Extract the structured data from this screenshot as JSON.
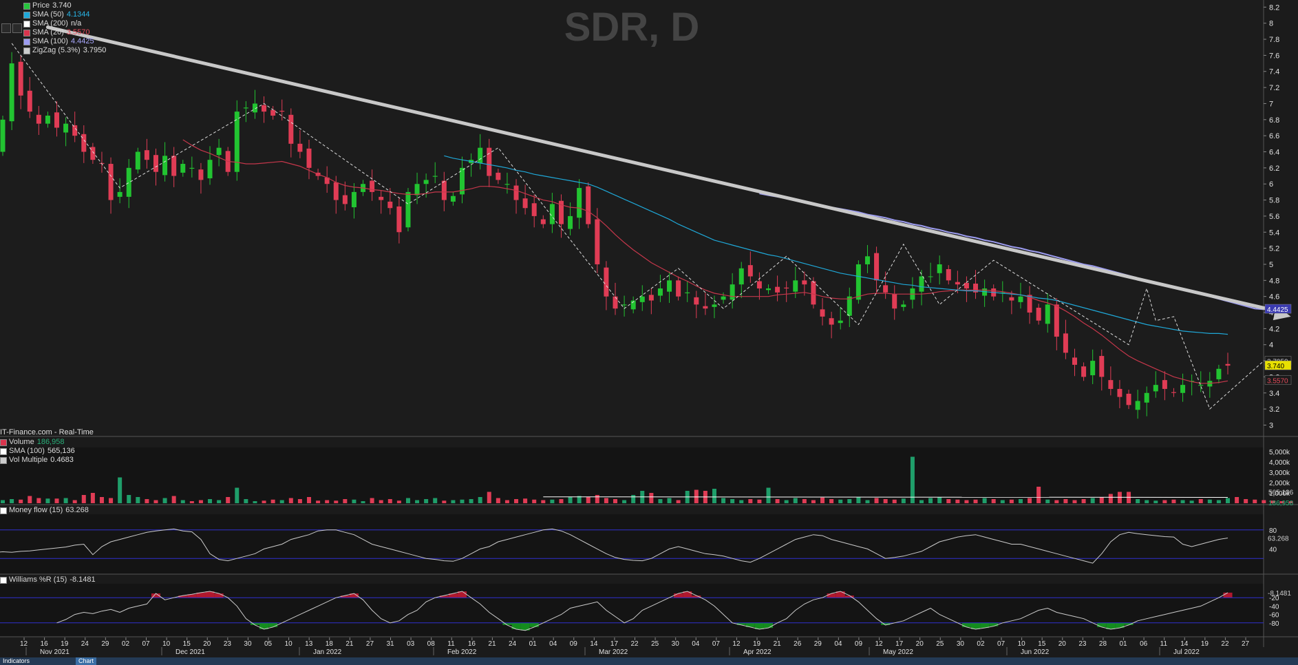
{
  "window": {
    "watermark": "SDR, D",
    "source_label": "IT-Finance.com - Real-Time",
    "price_tags": [
      "4.4425",
      "3.7950",
      "3.740",
      "3.5570"
    ]
  },
  "legend_price": [
    {
      "name": "Price",
      "value": "3.740",
      "color": "#26c43d",
      "value_color": "#e0e0e0"
    },
    {
      "name": "SMA (50)",
      "value": "4.1344",
      "color": "#1fa8d8",
      "value_color": "#29b6e8"
    },
    {
      "name": "SMA (200)",
      "value": "n/a",
      "color": "#ffffff",
      "value_color": "#e0e0e0"
    },
    {
      "name": "SMA (20)",
      "value": "3.5570",
      "color": "#d9344d",
      "value_color": "#e64a5a"
    },
    {
      "name": "SMA (100)",
      "value": "4.4425",
      "color": "#9c9cf0",
      "value_color": "#a9a9ff"
    },
    {
      "name": "ZigZag (5.3%)",
      "value": "3.7950",
      "color": "#cccccc",
      "value_color": "#e0e0e0"
    }
  ],
  "legend_volume": [
    {
      "name": "Volume",
      "value": "186,958",
      "color": "#d9344d",
      "value_color": "#2ab07a"
    },
    {
      "name": "SMA (100)",
      "value": "565,136",
      "color": "#ffffff",
      "value_color": "#e0e0e0"
    },
    {
      "name": "Vol Multiple",
      "value": "0.4683",
      "color": "#cccccc",
      "value_color": "#e0e0e0"
    }
  ],
  "legend_mfi": {
    "name": "Money flow (15)",
    "value": "63.268"
  },
  "legend_wr": {
    "name": "Williams %R (15)",
    "value": "-8.1481"
  },
  "colors": {
    "up": "#22c431",
    "down": "#e03c55",
    "grid": "#1b1b1b",
    "band": "#3030d0"
  },
  "chart_data": {
    "type": "candlestick",
    "price_axis": {
      "ticks": [
        "3",
        "3.2",
        "3.4",
        "3.6",
        "3.8",
        "4",
        "4.2",
        "4.4",
        "4.6",
        "4.8",
        "5",
        "5.2",
        "5.4",
        "5.6",
        "5.8",
        "6",
        "6.2",
        "6.4",
        "6.6",
        "6.8",
        "7",
        "7.2",
        "7.4",
        "7.6",
        "7.8",
        "8",
        "8.2"
      ],
      "range": [
        2.97,
        8.22
      ]
    },
    "volume_axis": {
      "ticks": [
        "5,000k",
        "4,000k",
        "3,000k",
        "2,000k",
        "1,000k"
      ],
      "tags": [
        "565,136",
        "186,958"
      ]
    },
    "mfi_axis": {
      "ticks": [
        "80",
        "40"
      ],
      "range": [
        0,
        100
      ],
      "bands": [
        80,
        20
      ]
    },
    "wr_axis": {
      "ticks": [
        "-20",
        "-40",
        "-60",
        "-80"
      ],
      "range": [
        -100,
        0
      ],
      "bands": [
        -20,
        -80
      ]
    },
    "x_day_ticks": [
      "12",
      "16",
      "19",
      "24",
      "29",
      "02",
      "07",
      "10",
      "15",
      "20",
      "23",
      "30",
      "05",
      "10",
      "13",
      "18",
      "21",
      "27",
      "31",
      "03",
      "08",
      "11",
      "16",
      "21",
      "24",
      "01",
      "04",
      "09",
      "14",
      "17",
      "22",
      "25",
      "30",
      "04",
      "07",
      "12",
      "19",
      "21",
      "26",
      "29",
      "04",
      "09",
      "12",
      "17",
      "20",
      "25",
      "30",
      "02",
      "07",
      "10",
      "15",
      "20",
      "23",
      "28",
      "01",
      "06",
      "11",
      "14",
      "19",
      "22",
      "27"
    ],
    "x_months": [
      "Nov 2021",
      "Dec 2021",
      "Jan 2022",
      "Feb 2022",
      "Mar 2022",
      "Apr 2022",
      "May 2022",
      "Jun 2022",
      "Jul 2022"
    ],
    "closes": [
      6.8,
      7.5,
      7.1,
      6.9,
      6.75,
      6.85,
      6.7,
      6.75,
      6.6,
      6.4,
      6.3,
      6.25,
      5.8,
      5.9,
      6.2,
      6.4,
      6.3,
      6.15,
      6.35,
      6.1,
      6.25,
      6.2,
      6.05,
      6.3,
      6.45,
      6.15,
      6.9,
      6.95,
      7.0,
      6.9,
      6.85,
      6.9,
      6.5,
      6.4,
      6.2,
      6.1,
      6.0,
      5.8,
      5.75,
      5.9,
      6.0,
      5.9,
      5.8,
      5.7,
      5.4,
      5.9,
      6.0,
      6.05,
      6.1,
      5.8,
      5.85,
      6.2,
      6.3,
      6.45,
      6.1,
      6.05,
      6.0,
      5.8,
      5.7,
      5.6,
      5.5,
      5.75,
      5.5,
      5.6,
      5.95,
      5.5,
      5.0,
      4.6,
      4.45,
      4.5,
      4.55,
      4.6,
      4.55,
      4.7,
      4.8,
      4.6,
      4.65,
      4.5,
      4.45,
      4.5,
      4.6,
      4.75,
      4.95,
      4.85,
      4.7,
      4.7,
      4.65,
      4.7,
      4.8,
      4.75,
      4.5,
      4.35,
      4.25,
      4.3,
      4.6,
      5.0,
      5.1,
      4.8,
      4.65,
      4.45,
      4.5,
      4.7,
      4.85,
      4.85,
      5.0,
      4.8,
      4.75,
      4.7,
      4.65,
      4.7,
      4.6,
      4.65,
      4.55,
      4.6,
      4.4,
      4.3,
      4.5,
      4.1,
      3.9,
      3.75,
      3.6,
      3.8,
      3.6,
      3.45,
      3.35,
      3.25,
      3.3,
      3.4,
      3.5,
      3.45,
      3.4,
      3.5,
      3.55,
      3.5,
      3.55,
      3.7,
      3.74
    ],
    "sma20": [
      null,
      null,
      null,
      null,
      null,
      null,
      null,
      null,
      null,
      null,
      null,
      null,
      null,
      null,
      null,
      null,
      null,
      null,
      null,
      null,
      6.55,
      6.48,
      6.42,
      6.38,
      6.33,
      6.28,
      6.27,
      6.25,
      6.25,
      6.26,
      6.27,
      6.28,
      6.25,
      6.22,
      6.17,
      6.12,
      6.08,
      6.02,
      5.98,
      5.96,
      5.95,
      5.93,
      5.92,
      5.9,
      5.88,
      5.87,
      5.87,
      5.88,
      5.9,
      5.9,
      5.9,
      5.92,
      5.94,
      5.97,
      5.97,
      5.96,
      5.94,
      5.92,
      5.88,
      5.84,
      5.8,
      5.78,
      5.74,
      5.71,
      5.7,
      5.66,
      5.58,
      5.48,
      5.37,
      5.27,
      5.18,
      5.1,
      5.02,
      4.96,
      4.9,
      4.84,
      4.79,
      4.73,
      4.68,
      4.64,
      4.62,
      4.6,
      4.6,
      4.6,
      4.6,
      4.6,
      4.62,
      4.63,
      4.64,
      4.65,
      4.63,
      4.6,
      4.58,
      4.57,
      4.57,
      4.6,
      4.63,
      4.64,
      4.64,
      4.63,
      4.63,
      4.63,
      4.63,
      4.64,
      4.66,
      4.67,
      4.68,
      4.68,
      4.68,
      4.68,
      4.67,
      4.66,
      4.64,
      4.62,
      4.59,
      4.55,
      4.52,
      4.48,
      4.42,
      4.35,
      4.27,
      4.2,
      4.12,
      4.03,
      3.94,
      3.86,
      3.8,
      3.75,
      3.7,
      3.65,
      3.6,
      3.57,
      3.54,
      3.52,
      3.52,
      3.53,
      3.55
    ],
    "sma50": [
      null,
      null,
      null,
      null,
      null,
      null,
      null,
      null,
      null,
      null,
      null,
      null,
      null,
      null,
      null,
      null,
      null,
      null,
      null,
      null,
      null,
      null,
      null,
      null,
      null,
      null,
      null,
      null,
      null,
      null,
      null,
      null,
      null,
      null,
      null,
      null,
      null,
      null,
      null,
      null,
      null,
      null,
      null,
      null,
      null,
      null,
      null,
      null,
      null,
      6.35,
      6.32,
      6.3,
      6.28,
      6.26,
      6.24,
      6.22,
      6.2,
      6.17,
      6.15,
      6.12,
      6.1,
      6.08,
      6.06,
      6.04,
      6.02,
      6.0,
      5.96,
      5.91,
      5.86,
      5.81,
      5.76,
      5.71,
      5.66,
      5.61,
      5.56,
      5.5,
      5.45,
      5.4,
      5.35,
      5.3,
      5.27,
      5.24,
      5.21,
      5.18,
      5.15,
      5.12,
      5.1,
      5.07,
      5.04,
      5.01,
      4.98,
      4.95,
      4.92,
      4.89,
      4.87,
      4.85,
      4.83,
      4.81,
      4.79,
      4.77,
      4.75,
      4.74,
      4.72,
      4.71,
      4.7,
      4.69,
      4.68,
      4.67,
      4.67,
      4.66,
      4.65,
      4.64,
      4.63,
      4.62,
      4.6,
      4.58,
      4.57,
      4.55,
      4.52,
      4.49,
      4.46,
      4.43,
      4.4,
      4.37,
      4.34,
      4.31,
      4.28,
      4.25,
      4.23,
      4.21,
      4.19,
      4.17,
      4.16,
      4.15,
      4.14,
      4.14,
      4.13
    ],
    "sma100": [
      5.88,
      5.86,
      5.84,
      5.82,
      5.8,
      5.78,
      5.76,
      5.73,
      5.71,
      5.69,
      5.67,
      5.65,
      5.62,
      5.6,
      5.58,
      5.55,
      5.53,
      5.5,
      5.48,
      5.45,
      5.43,
      5.4,
      5.38,
      5.35,
      5.33,
      5.3,
      5.28,
      5.25,
      5.22,
      5.2,
      5.17,
      5.15,
      5.12,
      5.09,
      5.06,
      5.03,
      5.0,
      4.98,
      4.95,
      4.92,
      4.89,
      4.86,
      4.83,
      4.8,
      4.77,
      4.74,
      4.71,
      4.69,
      4.66,
      4.63,
      4.6,
      4.57,
      4.54,
      4.51,
      4.48,
      4.45,
      4.44
    ],
    "sma100_start_index": 84,
    "zigzag": [
      [
        1,
        7.75
      ],
      [
        13,
        5.95
      ],
      [
        29,
        7.0
      ],
      [
        45,
        5.75
      ],
      [
        55,
        6.45
      ],
      [
        69,
        4.45
      ],
      [
        75,
        4.95
      ],
      [
        80,
        4.45
      ],
      [
        87,
        5.1
      ],
      [
        95,
        4.25
      ],
      [
        100,
        5.25
      ],
      [
        104,
        4.5
      ],
      [
        110,
        5.05
      ],
      [
        125,
        4.0
      ],
      [
        127,
        4.7
      ],
      [
        128,
        4.3
      ],
      [
        130,
        4.35
      ],
      [
        134,
        3.2
      ],
      [
        140,
        3.8
      ]
    ],
    "trendline": {
      "from": [
        5,
        7.95
      ],
      "to": [
        143,
        4.35
      ],
      "arrow": true
    },
    "volume_k": [
      300,
      400,
      350,
      700,
      500,
      450,
      450,
      500,
      300,
      800,
      1000,
      600,
      500,
      2500,
      800,
      600,
      400,
      300,
      500,
      700,
      300,
      200,
      300,
      400,
      300,
      600,
      1500,
      400,
      200,
      250,
      350,
      300,
      500,
      400,
      600,
      250,
      300,
      250,
      400,
      350,
      200,
      500,
      300,
      400,
      250,
      500,
      300,
      400,
      500,
      250,
      300,
      350,
      400,
      600,
      1100,
      500,
      300,
      400,
      450,
      350,
      300,
      350,
      400,
      600,
      700,
      600,
      800,
      500,
      400,
      300,
      800,
      1200,
      1000,
      400,
      500,
      300,
      1200,
      1300,
      1200,
      1400,
      500,
      400,
      300,
      400,
      350,
      1500,
      400,
      300,
      500,
      400,
      300,
      550,
      400,
      350,
      400,
      600,
      300,
      500,
      400,
      350,
      450,
      4500,
      300,
      500,
      600,
      400,
      350,
      300,
      350,
      500,
      400,
      300,
      350,
      400,
      500,
      1600,
      350,
      300,
      400,
      300,
      400,
      500,
      600,
      900,
      1100,
      1100,
      400,
      300,
      250,
      300,
      350,
      300,
      250,
      400,
      350,
      300,
      500,
      600,
      400,
      350,
      300,
      250,
      200,
      190
    ],
    "mfi": [
      30,
      32,
      34,
      33,
      35,
      36,
      38,
      40,
      42,
      44,
      48,
      50,
      28,
      45,
      55,
      60,
      65,
      70,
      75,
      78,
      80,
      82,
      78,
      76,
      60,
      30,
      18,
      15,
      20,
      25,
      30,
      40,
      45,
      50,
      60,
      65,
      70,
      78,
      80,
      80,
      75,
      70,
      60,
      50,
      45,
      40,
      35,
      30,
      25,
      20,
      18,
      15,
      14,
      20,
      30,
      40,
      45,
      55,
      60,
      65,
      70,
      75,
      80,
      82,
      78,
      70,
      60,
      50,
      40,
      30,
      22,
      18,
      16,
      15,
      20,
      30,
      40,
      45,
      40,
      35,
      30,
      28,
      25,
      20,
      15,
      12,
      20,
      30,
      40,
      50,
      60,
      65,
      70,
      68,
      60,
      55,
      50,
      45,
      40,
      30,
      20,
      22,
      25,
      30,
      35,
      45,
      55,
      60,
      65,
      68,
      70,
      65,
      60,
      55,
      50,
      50,
      45,
      40,
      35,
      30,
      25,
      20,
      15,
      10,
      30,
      55,
      70,
      75,
      72,
      70,
      68,
      66,
      65,
      50,
      45,
      50,
      55,
      60,
      63
    ],
    "wr": [
      -80,
      -72,
      -60,
      -55,
      -58,
      -52,
      -48,
      -55,
      -45,
      -40,
      -35,
      -10,
      -25,
      -20,
      -15,
      -12,
      -8,
      -5,
      -10,
      -20,
      -40,
      -70,
      -85,
      -95,
      -90,
      -80,
      -70,
      -60,
      -50,
      -40,
      -30,
      -20,
      -15,
      -10,
      -25,
      -50,
      -70,
      -80,
      -75,
      -60,
      -50,
      -30,
      -20,
      -15,
      -10,
      -5,
      -20,
      -35,
      -55,
      -70,
      -85,
      -95,
      -98,
      -90,
      -80,
      -70,
      -60,
      -45,
      -40,
      -35,
      -30,
      -50,
      -65,
      -80,
      -70,
      -50,
      -40,
      -30,
      -20,
      -10,
      -5,
      -15,
      -25,
      -40,
      -60,
      -80,
      -85,
      -90,
      -95,
      -92,
      -80,
      -70,
      -50,
      -35,
      -25,
      -20,
      -10,
      -5,
      -15,
      -30,
      -50,
      -70,
      -85,
      -80,
      -75,
      -65,
      -55,
      -45,
      -60,
      -70,
      -80,
      -90,
      -95,
      -92,
      -88,
      -80,
      -75,
      -70,
      -60,
      -50,
      -45,
      -55,
      -60,
      -65,
      -70,
      -80,
      -90,
      -95,
      -92,
      -85,
      -75,
      -70,
      -65,
      -60,
      -55,
      -50,
      -45,
      -40,
      -30,
      -20,
      -8
    ]
  },
  "taskbar": {
    "start_label": "Indicators",
    "chart_label": "Chart"
  }
}
